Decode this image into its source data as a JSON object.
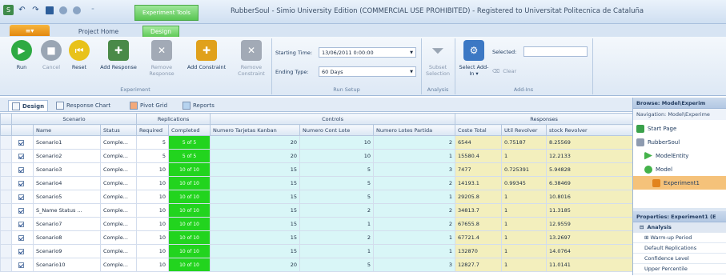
{
  "window": {
    "context_tab": "Experiment Tools",
    "title": "RubberSoul - Simio University Edition (COMMERCIAL USE PROHIBITED) - Registered to Universitat Politecnica de Cataluña"
  },
  "ribbon_tabs": {
    "file": "≡▾",
    "project_home": "Project Home",
    "design": "Design"
  },
  "ribbon": {
    "run": "Run",
    "cancel": "Cancel",
    "reset": "Reset",
    "add_response": "Add Response",
    "remove_response": "Remove Response",
    "add_constraint": "Add Constraint",
    "remove_constraint": "Remove Constraint",
    "group_experiment": "Experiment",
    "starting_time_label": "Starting Time:",
    "starting_time_value": "13/06/2011 0:00:00",
    "ending_type_label": "Ending Type:",
    "ending_type_value": "60 Days",
    "group_run_setup": "Run Setup",
    "subset_selection": "Subset Selection",
    "group_analysis": "Analysis",
    "select_addin": "Select Add-In ▾",
    "selected_label": "Selected:",
    "clear": "Clear",
    "group_addins": "Add-Ins"
  },
  "doc_tabs": {
    "design": "Design",
    "response_chart": "Response Chart",
    "pivot_grid": "Pivot Grid",
    "reports": "Reports"
  },
  "grid": {
    "group_headers": {
      "scenario": "Scenario",
      "replications": "Replications",
      "controls": "Controls",
      "responses": "Responses"
    },
    "columns": {
      "name": "Name",
      "status": "Status",
      "required": "Required",
      "completed": "Completed",
      "kanban": "Numero Tarjetas Kanban",
      "cont_lote": "Numero Cont Lote",
      "lotes_partida": "Numero Lotes Partida",
      "coste": "Coste Total",
      "util": "Util Revolver",
      "stock": "stock Revolver"
    },
    "rows": [
      {
        "name": "Scenario1",
        "status": "Comple...",
        "required": "5",
        "completed": "5 of 5",
        "kanban": "20",
        "cont_lote": "10",
        "lotes_partida": "2",
        "coste": "6544",
        "util": "0.75187",
        "stock": "8.25569"
      },
      {
        "name": "Scenario2",
        "status": "Comple...",
        "required": "5",
        "completed": "5 of 5",
        "kanban": "20",
        "cont_lote": "10",
        "lotes_partida": "1",
        "coste": "15580.4",
        "util": "1",
        "stock": "12.2133"
      },
      {
        "name": "Scenario3",
        "status": "Comple...",
        "required": "10",
        "completed": "10 of 10",
        "kanban": "15",
        "cont_lote": "5",
        "lotes_partida": "3",
        "coste": "7477",
        "util": "0.725391",
        "stock": "5.94828"
      },
      {
        "name": "Scenario4",
        "status": "Comple...",
        "required": "10",
        "completed": "10 of 10",
        "kanban": "15",
        "cont_lote": "5",
        "lotes_partida": "2",
        "coste": "14193.1",
        "util": "0.99345",
        "stock": "6.38469"
      },
      {
        "name": "Scenario5",
        "status": "Comple...",
        "required": "10",
        "completed": "10 of 10",
        "kanban": "15",
        "cont_lote": "5",
        "lotes_partida": "1",
        "coste": "29205.8",
        "util": "1",
        "stock": "10.8016"
      },
      {
        "name": "S_Name Status ...",
        "status": "Comple...",
        "required": "10",
        "completed": "10 of 10",
        "kanban": "15",
        "cont_lote": "2",
        "lotes_partida": "2",
        "coste": "34813.7",
        "util": "1",
        "stock": "11.3185"
      },
      {
        "name": "Scenario7",
        "status": "Comple...",
        "required": "10",
        "completed": "10 of 10",
        "kanban": "15",
        "cont_lote": "1",
        "lotes_partida": "2",
        "coste": "67655.8",
        "util": "1",
        "stock": "12.9559"
      },
      {
        "name": "Scenario8",
        "status": "Comple...",
        "required": "10",
        "completed": "10 of 10",
        "kanban": "15",
        "cont_lote": "2",
        "lotes_partida": "1",
        "coste": "67721.4",
        "util": "1",
        "stock": "13.2697"
      },
      {
        "name": "Scenario9",
        "status": "Comple...",
        "required": "10",
        "completed": "10 of 10",
        "kanban": "15",
        "cont_lote": "1",
        "lotes_partida": "1",
        "coste": "132870",
        "util": "1",
        "stock": "14.0764"
      },
      {
        "name": "Scenario10",
        "status": "Comple...",
        "required": "10",
        "completed": "10 of 10",
        "kanban": "20",
        "cont_lote": "5",
        "lotes_partida": "3",
        "coste": "12827.7",
        "util": "1",
        "stock": "11.0141"
      }
    ]
  },
  "side": {
    "browse_title": "Browse: Model\\Experim",
    "navigation": "Navigation: Model\\Experime",
    "tree": {
      "start_page": "Start Page",
      "project": "RubberSoul",
      "model_entity": "ModelEntity",
      "model": "Model",
      "experiment": "Experiment1"
    },
    "properties_title": "Properties: Experiment1 (E",
    "props": {
      "analysis": "Analysis",
      "warmup": "⊞ Warm-up Period",
      "default_reps": "Default Replications",
      "confidence": "Confidence Level",
      "upper": "Upper Percentile"
    }
  }
}
